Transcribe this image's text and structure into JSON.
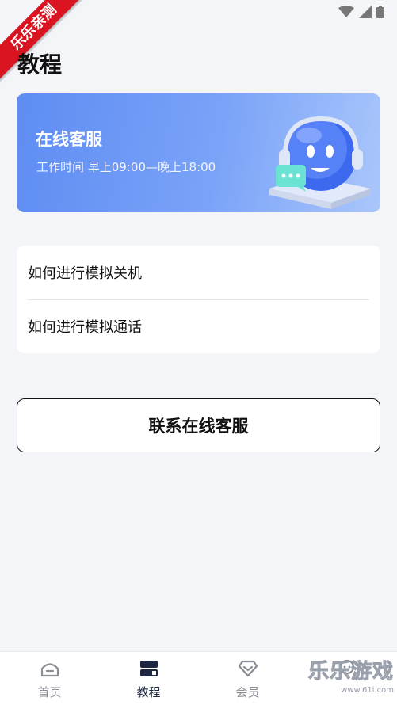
{
  "ribbon": {
    "text": "乐乐亲测"
  },
  "page": {
    "title": "教程"
  },
  "service_card": {
    "title": "在线客服",
    "hours": "工作时间 早上09:00—晚上18:00",
    "illustration": "robot-headset-chat"
  },
  "tutorials": [
    {
      "label": "如何进行模拟关机"
    },
    {
      "label": "如何进行模拟通话"
    }
  ],
  "contact_button": {
    "label": "联系在线客服"
  },
  "tab_bar": {
    "items": [
      {
        "label": "首页",
        "icon": "home-icon",
        "active": false
      },
      {
        "label": "教程",
        "icon": "book-icon",
        "active": true
      },
      {
        "label": "会员",
        "icon": "diamond-icon",
        "active": false
      },
      {
        "label": "",
        "icon": "profile-icon",
        "active": false
      }
    ]
  },
  "watermark": {
    "text": "乐乐游戏",
    "url": "www.61i.com"
  },
  "colors": {
    "accent": "#5e8cf2",
    "active_tab": "#1e2740",
    "inactive_tab": "#8b8e96"
  }
}
